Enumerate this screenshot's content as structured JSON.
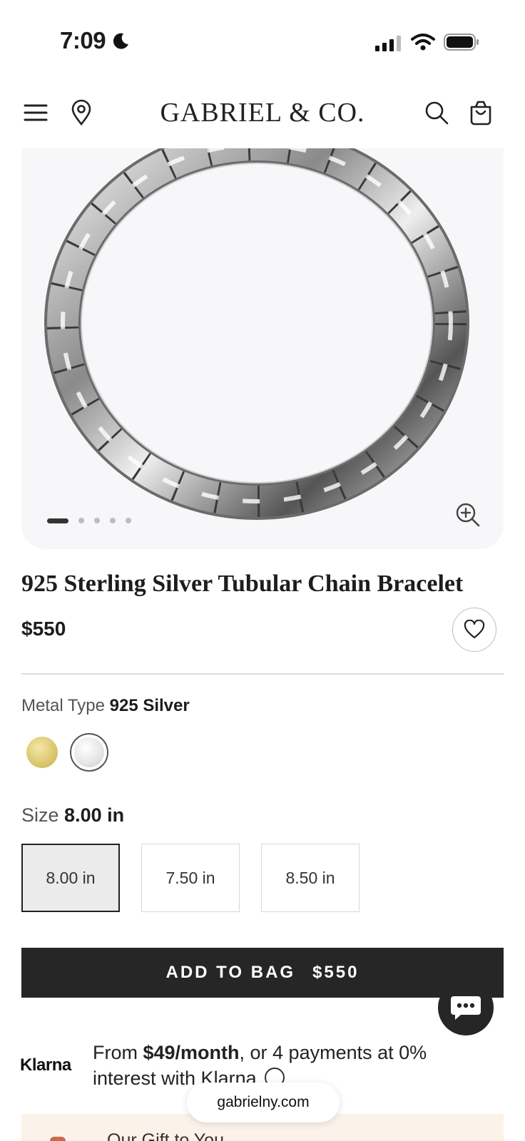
{
  "status_bar": {
    "time": "7:09",
    "icons": [
      "moon-icon",
      "cellular-signal-icon",
      "wifi-icon",
      "battery-icon"
    ]
  },
  "header": {
    "brand": "GABRIEL & CO.",
    "icons": [
      "menu-icon",
      "location-pin-icon",
      "search-icon",
      "shopping-bag-icon"
    ]
  },
  "gallery": {
    "image_count": 5,
    "active_index": 0,
    "zoom_icon": "zoom-in-icon"
  },
  "product": {
    "title": "925 Sterling Silver Tubular Chain Bracelet",
    "price": "$550",
    "wishlist_icon": "heart-icon"
  },
  "metal": {
    "label": "Metal Type",
    "selected": "925 Silver",
    "swatches": [
      {
        "name": "Yellow Gold",
        "color": "#d8c36a",
        "selected": false
      },
      {
        "name": "925 Silver",
        "color": "#e6e6e8",
        "selected": true
      }
    ]
  },
  "size": {
    "label": "Size",
    "selected": "8.00 in",
    "options": [
      "8.00 in",
      "7.50 in",
      "8.50 in"
    ]
  },
  "add_to_bag": {
    "label": "ADD TO BAG",
    "price": "$550"
  },
  "klarna": {
    "logo": "Klarna",
    "text_prefix": "From ",
    "amount": "$49/month",
    "text_suffix": ", or 4 payments at 0% interest with Klarna"
  },
  "gift": {
    "text": "Our Gift to You"
  },
  "browser": {
    "url": "gabrielny.com"
  },
  "colors": {
    "button_dark": "#262626",
    "gift_bg": "#fbf2ea"
  }
}
